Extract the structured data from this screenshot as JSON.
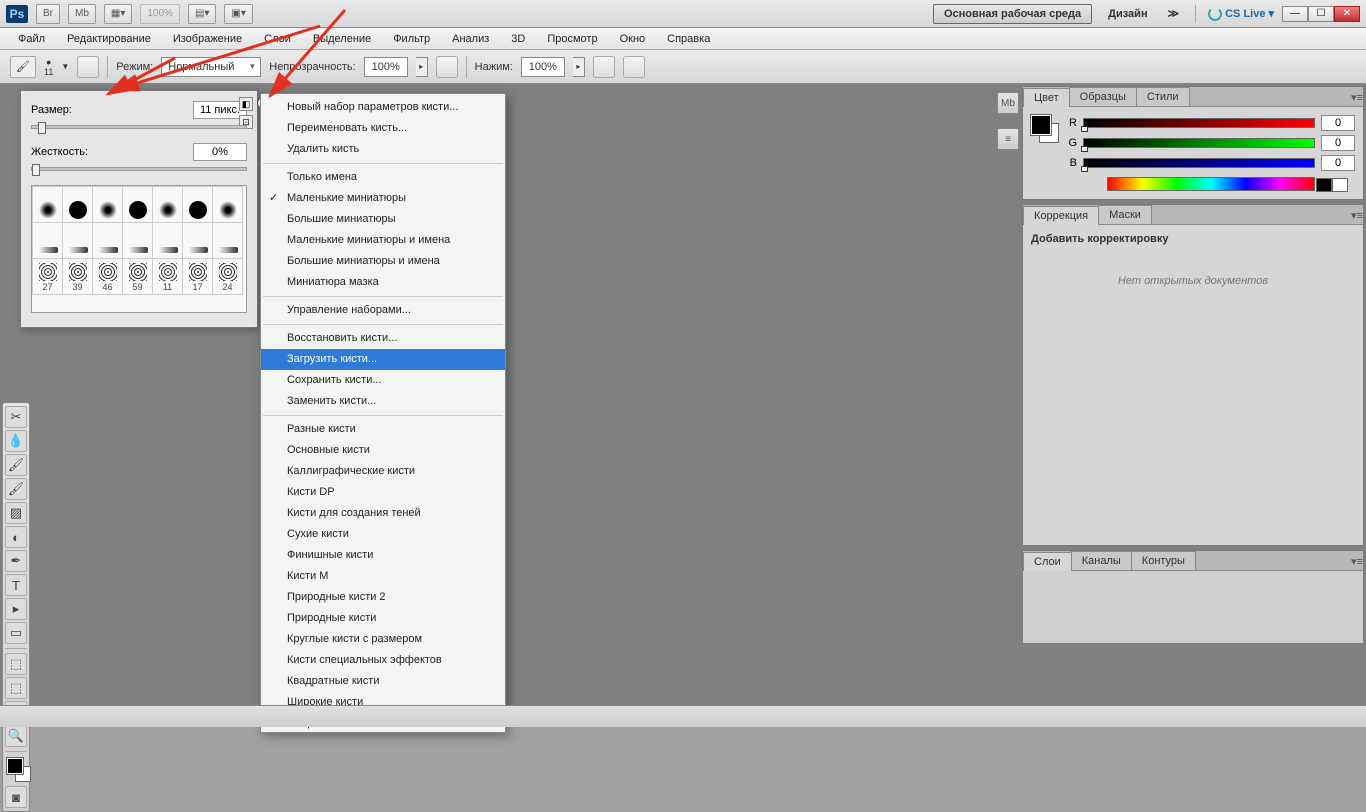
{
  "appbar": {
    "zoom": "100%",
    "workspace_active": "Основная рабочая среда",
    "workspace_alt": "Дизайн",
    "cslive": "CS Live"
  },
  "menu": [
    "Файл",
    "Редактирование",
    "Изображение",
    "Слои",
    "Выделение",
    "Фильтр",
    "Анализ",
    "3D",
    "Просмотр",
    "Окно",
    "Справка"
  ],
  "options": {
    "brush_size_num": "11",
    "mode_label": "Режим:",
    "mode_value": "Нормальный",
    "opacity_label": "Непрозрачность:",
    "opacity_value": "100%",
    "flow_label": "Нажим:",
    "flow_value": "100%"
  },
  "brush_popup": {
    "size_label": "Размер:",
    "size_value": "11 пикс.",
    "hardness_label": "Жесткость:",
    "hardness_value": "0%",
    "row3": [
      "27",
      "39",
      "46",
      "59",
      "11",
      "17",
      "24"
    ]
  },
  "context_menu": {
    "g1": [
      "Новый набор параметров кисти...",
      "Переименовать кисть...",
      "Удалить кисть"
    ],
    "g2": [
      "Только имена",
      "Маленькие миниатюры",
      "Большие миниатюры",
      "Маленькие миниатюры и имена",
      "Большие миниатюры и имена",
      "Миниатюра мазка"
    ],
    "checked": "Маленькие миниатюры",
    "g3": [
      "Управление наборами..."
    ],
    "g4": [
      "Восстановить кисти...",
      "Загрузить кисти...",
      "Сохранить кисти...",
      "Заменить кисти..."
    ],
    "highlighted": "Загрузить кисти...",
    "g5": [
      "Разные кисти",
      "Основные кисти",
      "Каллиграфические кисти",
      "Кисти DP",
      "Кисти для создания теней",
      "Сухие кисти",
      "Финишные кисти",
      "Кисти M",
      "Природные кисти 2",
      "Природные кисти",
      "Круглые кисти с размером",
      "Кисти специальных эффектов",
      "Квадратные кисти",
      "Широкие кисти",
      "Мокрые кисти"
    ]
  },
  "panels": {
    "color": {
      "tabs": [
        "Цвет",
        "Образцы",
        "Стили"
      ],
      "r": "0",
      "g": "0",
      "b": "0"
    },
    "adjust": {
      "tabs": [
        "Коррекция",
        "Маски"
      ],
      "title": "Добавить корректировку",
      "hint": "Нет открытых документов"
    },
    "layers": {
      "tabs": [
        "Слои",
        "Каналы",
        "Контуры"
      ]
    }
  }
}
